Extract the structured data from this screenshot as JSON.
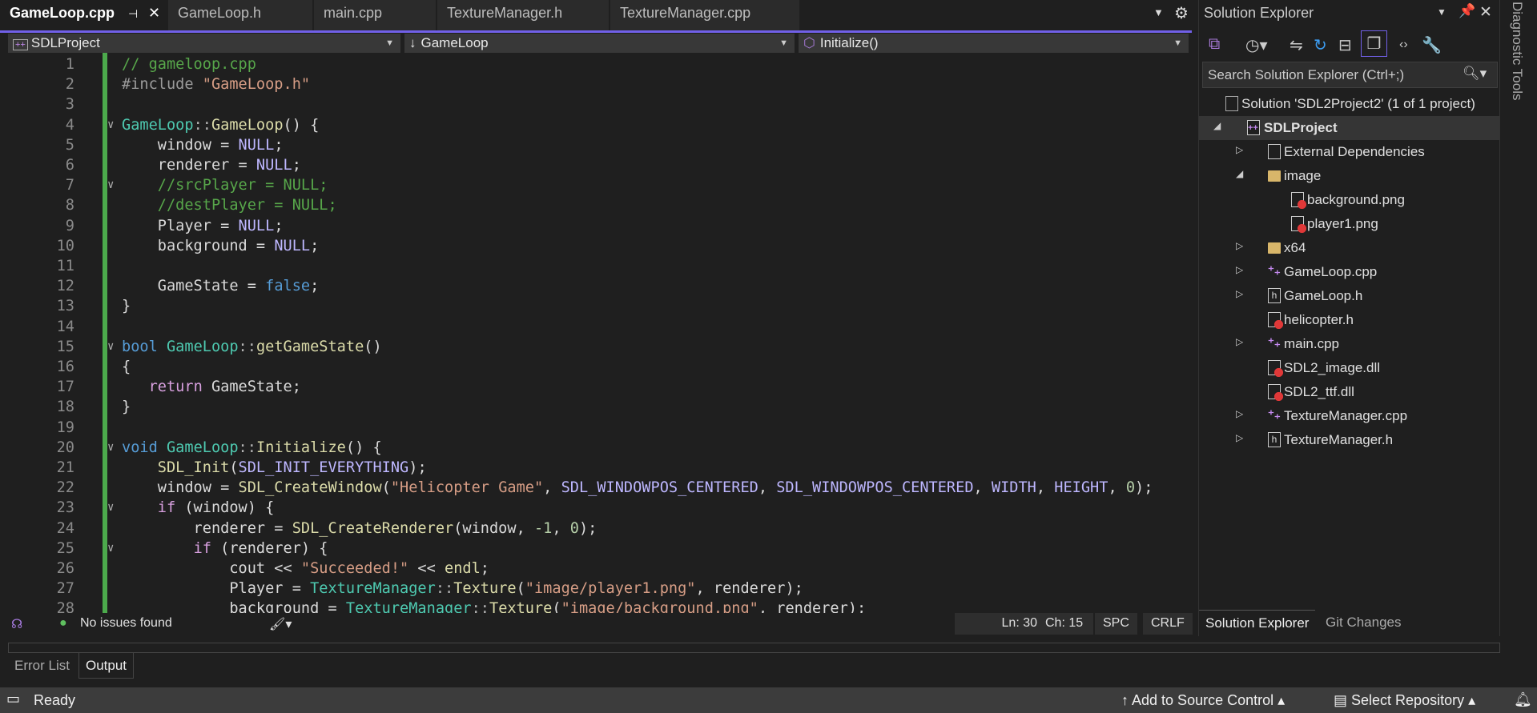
{
  "tabs": [
    {
      "label": "GameLoop.cpp",
      "active": true
    },
    {
      "label": "GameLoop.h"
    },
    {
      "label": "main.cpp"
    },
    {
      "label": "TextureManager.h"
    },
    {
      "label": "TextureManager.cpp"
    }
  ],
  "nav": {
    "project": "SDLProject",
    "scope": "GameLoop",
    "member": "Initialize()"
  },
  "code": [
    [
      [
        "// gameloop.cpp",
        "cm"
      ]
    ],
    [
      [
        "#include ",
        "pp"
      ],
      [
        "\"GameLoop.h\"",
        "st"
      ]
    ],
    [],
    [
      [
        "GameLoop",
        "ty"
      ],
      [
        "::",
        "op"
      ],
      [
        "GameLoop",
        "fn"
      ],
      [
        "() {",
        "pl"
      ]
    ],
    [
      [
        "    window = ",
        "pl"
      ],
      [
        "NULL",
        "mc"
      ],
      [
        ";",
        "pl"
      ]
    ],
    [
      [
        "    renderer = ",
        "pl"
      ],
      [
        "NULL",
        "mc"
      ],
      [
        ";",
        "pl"
      ]
    ],
    [
      [
        "    //srcPlayer = NULL;",
        "cm"
      ]
    ],
    [
      [
        "    //destPlayer = NULL;",
        "cm"
      ]
    ],
    [
      [
        "    Player = ",
        "pl"
      ],
      [
        "NULL",
        "mc"
      ],
      [
        ";",
        "pl"
      ]
    ],
    [
      [
        "    background = ",
        "pl"
      ],
      [
        "NULL",
        "mc"
      ],
      [
        ";",
        "pl"
      ]
    ],
    [],
    [
      [
        "    GameState = ",
        "pl"
      ],
      [
        "false",
        "kw"
      ],
      [
        ";",
        "pl"
      ]
    ],
    [
      [
        "}",
        "pl"
      ]
    ],
    [],
    [
      [
        "bool ",
        "kw"
      ],
      [
        "GameLoop",
        "ty"
      ],
      [
        "::",
        "op"
      ],
      [
        "getGameState",
        "fn"
      ],
      [
        "()",
        "pl"
      ]
    ],
    [
      [
        "{",
        "pl"
      ]
    ],
    [
      [
        "   ",
        "pl"
      ],
      [
        "return",
        "ctl"
      ],
      [
        " GameState;",
        "pl"
      ]
    ],
    [
      [
        "}",
        "pl"
      ]
    ],
    [],
    [
      [
        "void ",
        "kw"
      ],
      [
        "GameLoop",
        "ty"
      ],
      [
        "::",
        "op"
      ],
      [
        "Initialize",
        "fn"
      ],
      [
        "() {",
        "pl"
      ]
    ],
    [
      [
        "    ",
        "pl"
      ],
      [
        "SDL_Init",
        "fn"
      ],
      [
        "(",
        "pl"
      ],
      [
        "SDL_INIT_EVERYTHING",
        "mc"
      ],
      [
        ");",
        "pl"
      ]
    ],
    [
      [
        "    window = ",
        "pl"
      ],
      [
        "SDL_CreateWindow",
        "fn"
      ],
      [
        "(",
        "pl"
      ],
      [
        "\"Helicopter Game\"",
        "st"
      ],
      [
        ", ",
        "pl"
      ],
      [
        "SDL_WINDOWPOS_CENTERED",
        "mc"
      ],
      [
        ", ",
        "pl"
      ],
      [
        "SDL_WINDOWPOS_CENTERED",
        "mc"
      ],
      [
        ", ",
        "pl"
      ],
      [
        "WIDTH",
        "mc"
      ],
      [
        ", ",
        "pl"
      ],
      [
        "HEIGHT",
        "mc"
      ],
      [
        ", ",
        "pl"
      ],
      [
        "0",
        "nu"
      ],
      [
        ");",
        "pl"
      ]
    ],
    [
      [
        "    ",
        "pl"
      ],
      [
        "if",
        "ctl"
      ],
      [
        " (window) {",
        "pl"
      ]
    ],
    [
      [
        "        renderer = ",
        "pl"
      ],
      [
        "SDL_CreateRenderer",
        "fn"
      ],
      [
        "(window, ",
        "pl"
      ],
      [
        "-1",
        "nu"
      ],
      [
        ", ",
        "pl"
      ],
      [
        "0",
        "nu"
      ],
      [
        ");",
        "pl"
      ]
    ],
    [
      [
        "        ",
        "pl"
      ],
      [
        "if",
        "ctl"
      ],
      [
        " (renderer) {",
        "pl"
      ]
    ],
    [
      [
        "            cout << ",
        "pl"
      ],
      [
        "\"Succeeded!\"",
        "st"
      ],
      [
        " << ",
        "pl"
      ],
      [
        "endl",
        "fn"
      ],
      [
        ";",
        "pl"
      ]
    ],
    [
      [
        "            Player = ",
        "pl"
      ],
      [
        "TextureManager",
        "ty"
      ],
      [
        "::",
        "op"
      ],
      [
        "Texture",
        "fn"
      ],
      [
        "(",
        "pl"
      ],
      [
        "\"image/player1.png\"",
        "st"
      ],
      [
        ", renderer);",
        "pl"
      ]
    ],
    [
      [
        "            background = ",
        "pl"
      ],
      [
        "TextureManager",
        "ty"
      ],
      [
        "::",
        "op"
      ],
      [
        "Texture",
        "fn"
      ],
      [
        "(",
        "pl"
      ],
      [
        "\"image/background.png\"",
        "st"
      ],
      [
        ", renderer);",
        "pl"
      ]
    ]
  ],
  "fold_lines": [
    4,
    7,
    15,
    20,
    23,
    25
  ],
  "editor_status": {
    "issues": "No issues found",
    "ln": "Ln: 30",
    "ch": "Ch: 15",
    "spc": "SPC",
    "crlf": "CRLF"
  },
  "solution_explorer": {
    "title": "Solution Explorer",
    "search_placeholder": "Search Solution Explorer (Ctrl+;)",
    "solution": "Solution 'SDL2Project2' (1 of 1 project)",
    "project": "SDLProject",
    "items": [
      {
        "label": "External Dependencies",
        "level": 1,
        "arrow": "right",
        "icon": "ext"
      },
      {
        "label": "image",
        "level": 1,
        "arrow": "down",
        "icon": "folder"
      },
      {
        "label": "background.png",
        "level": 2,
        "arrow": "",
        "icon": "red"
      },
      {
        "label": "player1.png",
        "level": 2,
        "arrow": "",
        "icon": "red"
      },
      {
        "label": "x64",
        "level": 1,
        "arrow": "right",
        "icon": "folder"
      },
      {
        "label": "GameLoop.cpp",
        "level": 1,
        "arrow": "right",
        "icon": "cpp"
      },
      {
        "label": "GameLoop.h",
        "level": 1,
        "arrow": "right",
        "icon": "h"
      },
      {
        "label": "helicopter.h",
        "level": 1,
        "arrow": "",
        "icon": "red"
      },
      {
        "label": "main.cpp",
        "level": 1,
        "arrow": "right",
        "icon": "cpp"
      },
      {
        "label": "SDL2_image.dll",
        "level": 1,
        "arrow": "",
        "icon": "red"
      },
      {
        "label": "SDL2_ttf.dll",
        "level": 1,
        "arrow": "",
        "icon": "red"
      },
      {
        "label": "TextureManager.cpp",
        "level": 1,
        "arrow": "right",
        "icon": "cpp"
      },
      {
        "label": "TextureManager.h",
        "level": 1,
        "arrow": "right",
        "icon": "h"
      }
    ],
    "bottom_tabs": [
      "Solution Explorer",
      "Git Changes"
    ]
  },
  "diagnostic_tools": "Diagnostic Tools",
  "output_tabs": [
    "Error List",
    "Output"
  ],
  "status": {
    "ready": "Ready",
    "source_control": "Add to Source Control",
    "repository": "Select Repository"
  }
}
